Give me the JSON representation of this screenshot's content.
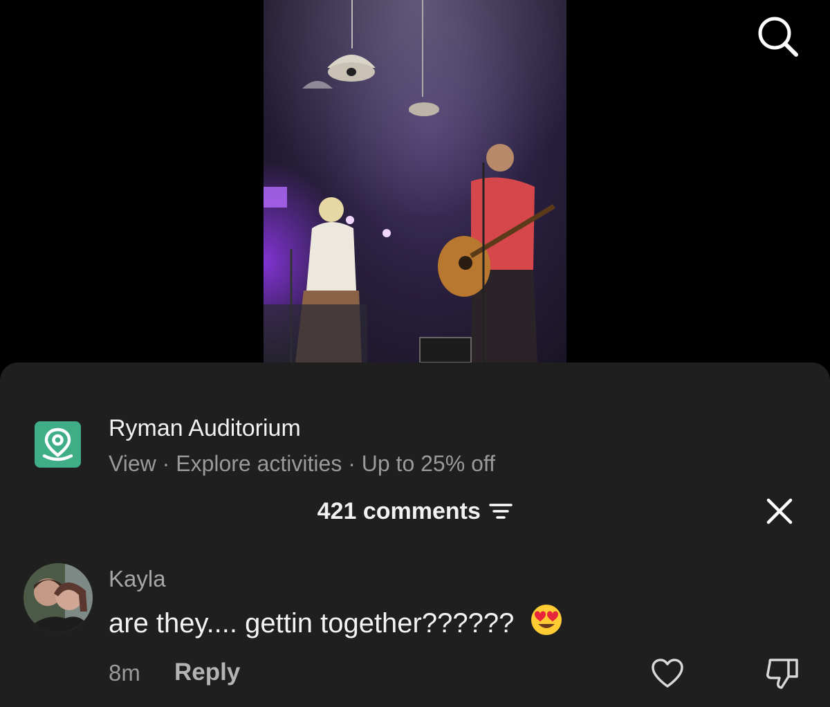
{
  "location": {
    "title": "Ryman Auditorium",
    "subtitle": "View · Explore activities · Up to 25% off",
    "icon": "map-pin-icon",
    "icon_bg": "#3fae86"
  },
  "comments_header": {
    "count_label": "421 comments",
    "filter_icon": "filter-icon",
    "close_icon": "close-icon"
  },
  "comment": {
    "author": "Kayla",
    "text": "are they.... gettin together??????",
    "emoji": "heart-eyes-emoji",
    "time": "8m",
    "reply_label": "Reply"
  },
  "colors": {
    "sheet_bg": "#1f1f1f",
    "page_bg": "#000000",
    "muted_text": "#9a9a9a"
  }
}
